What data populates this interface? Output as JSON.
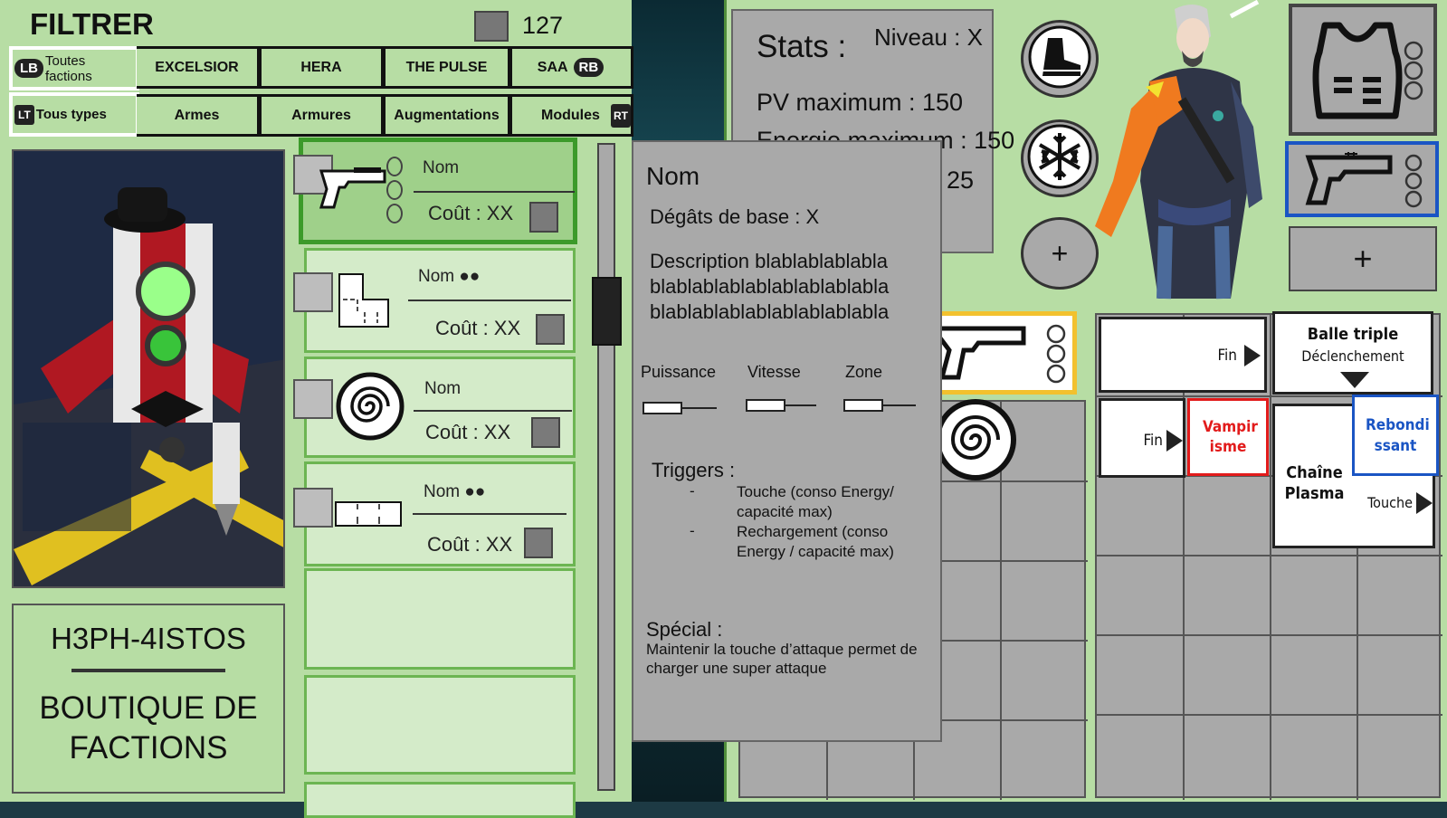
{
  "filter": {
    "title": "FILTRER",
    "count": "127"
  },
  "faction_tabs": [
    {
      "badge": "LB",
      "label": "Toutes factions"
    },
    {
      "label": "EXCELSIOR"
    },
    {
      "label": "HERA"
    },
    {
      "label": "THE PULSE"
    },
    {
      "label": "SAA",
      "badge": "RB"
    }
  ],
  "type_tabs": [
    {
      "badge": "LT",
      "label": "Tous types"
    },
    {
      "label": "Armes"
    },
    {
      "label": "Armures"
    },
    {
      "label": "Augmentations"
    },
    {
      "label": "Modules",
      "badge": "RT"
    }
  ],
  "shop": {
    "vendor": "H3PH-4ISTOS",
    "name_line1": "BOUTIQUE DE",
    "name_line2": "FACTIONS"
  },
  "items": [
    {
      "name": "Nom",
      "cost": "Coût : XX",
      "icon": "pistol-icon"
    },
    {
      "name": "Nom ●●",
      "cost": "Coût : XX",
      "icon": "shape-icon"
    },
    {
      "name": "Nom",
      "cost": "Coût : XX",
      "icon": "spiral-icon"
    },
    {
      "name": "Nom ●●",
      "cost": "Coût : XX",
      "icon": "bar-icon"
    }
  ],
  "stats": {
    "title": "Stats :",
    "level": "Niveau : X",
    "hp": "PV maximum : 150",
    "energy": "Energie maximum : 150",
    "third_visible": "25"
  },
  "tooltip": {
    "name": "Nom",
    "damage": "Dégâts de base : X",
    "desc1": "Description blablablablabla",
    "desc2": "blablablablablablablablabla",
    "desc3": "blablablablablablablablabla",
    "power": "Puissance",
    "speed": "Vitesse",
    "zone": "Zone",
    "triggers_title": "Triggers :",
    "trigger1": "Touche (conso Energy/ capacité max)",
    "trigger2": "Rechargement (conso Energy / capacité max)",
    "dash": "-",
    "special_title": "Spécial :",
    "special_text": "Maintenir la touche d’attaque permet de charger une super attaque"
  },
  "stat_levels": {
    "power": 0.55,
    "speed": 0.5,
    "zone": 0.75
  },
  "buttons": {
    "plus": "+"
  },
  "modules": {
    "fin1": "Fin",
    "fin2": "Fin",
    "triple_title": "Balle triple",
    "triple_sub": "Déclenchement",
    "vampire": "Vampir isme",
    "rebond": "Rebondi ssant",
    "plasma": "Chaîne Plasma",
    "touche": "Touche"
  },
  "colors": {
    "panel": "#b7dda4",
    "selected": "#3c9a2a",
    "vampire": "#e21b1b",
    "rebond": "#1a55c4",
    "gold": "#f2c12e"
  }
}
